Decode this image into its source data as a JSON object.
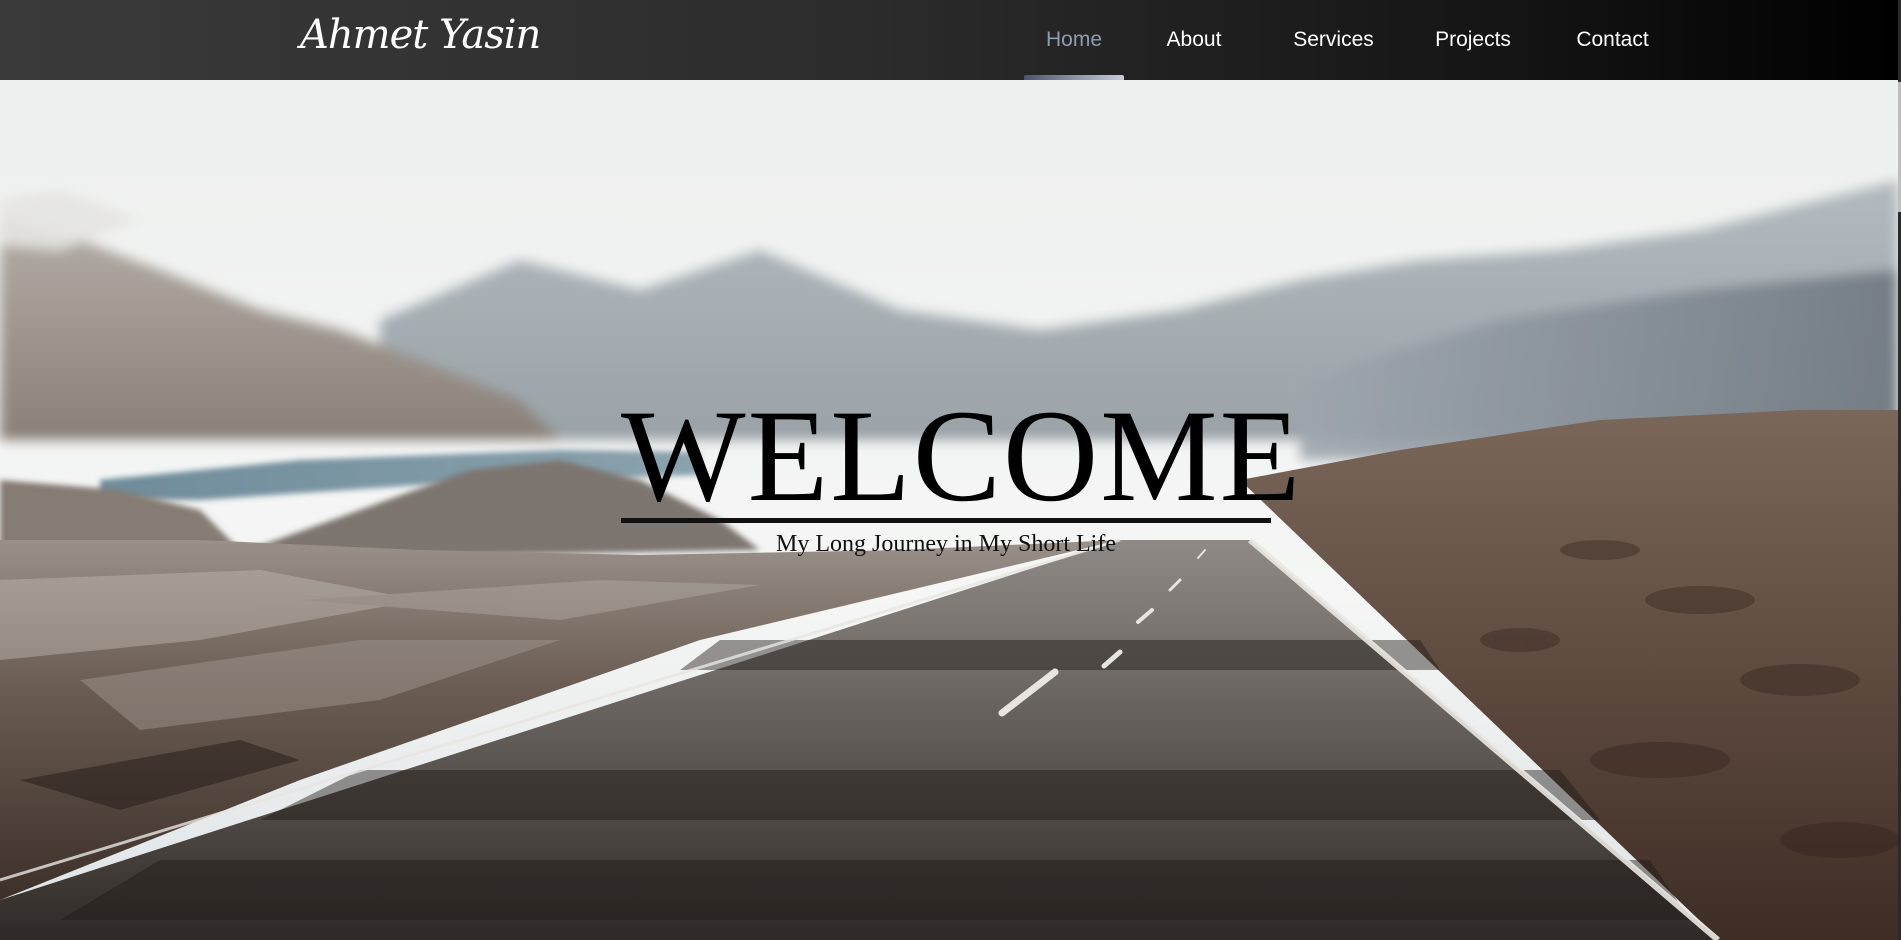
{
  "brand": {
    "name": "Ahmet Yasin"
  },
  "nav": {
    "items": [
      {
        "label": "Home",
        "active": true
      },
      {
        "label": "About",
        "active": false
      },
      {
        "label": "Services",
        "active": false
      },
      {
        "label": "Projects",
        "active": false
      },
      {
        "label": "Contact",
        "active": false
      }
    ]
  },
  "hero": {
    "title": "WELCOME",
    "subtitle": "My Long Journey in My Short Life",
    "background": "road-through-mountain-valley-image"
  },
  "colors": {
    "nav_background": "#2c2c2c",
    "nav_active_text": "#8f9bb0",
    "nav_text": "#ffffff",
    "title_text": "#000000"
  }
}
